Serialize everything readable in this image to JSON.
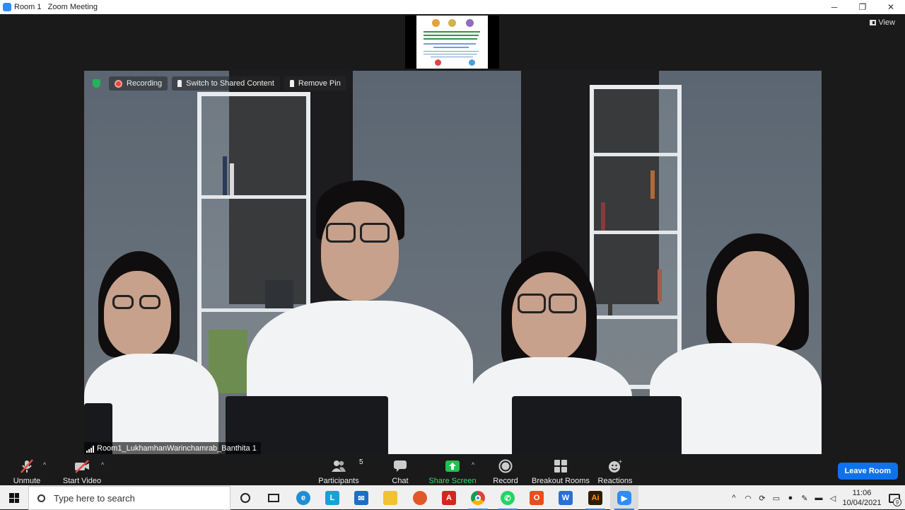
{
  "window": {
    "title": "Room 1   Zoom Meeting",
    "controls": [
      "─",
      "❐",
      "✕"
    ]
  },
  "view_button": {
    "label": "View"
  },
  "meeting_overlay": {
    "recording_label": "Recording",
    "switch_label": "Switch to Shared Content",
    "remove_pin_label": "Remove Pin"
  },
  "participant_name": "Room1_LukhamhanWarinchamrab_Banthita 1",
  "toolbar": {
    "unmute": "Unmute",
    "start_video": "Start Video",
    "participants": "Participants",
    "participants_count": "5",
    "chat": "Chat",
    "share_screen": "Share Screen",
    "record": "Record",
    "breakout_rooms": "Breakout Rooms",
    "reactions": "Reactions",
    "leave_room": "Leave Room"
  },
  "taskbar": {
    "search_placeholder": "Type here to search",
    "time": "11:06",
    "date": "10/04/2021",
    "notification_count": "9",
    "pinned_apps": [
      "cortana-icon",
      "task-view-icon",
      "edge-icon",
      "app-l-icon",
      "mail-icon",
      "file-explorer-icon",
      "firefox-icon",
      "acrobat-icon",
      "chrome-icon",
      "whatsapp-icon",
      "office-icon",
      "wps-icon",
      "illustrator-icon",
      "zoom-icon"
    ]
  },
  "colors": {
    "accent": "#0e72ed",
    "share_green": "#23c050",
    "record_red": "#e5483c",
    "toolbar_bg": "#1a1a1a"
  }
}
